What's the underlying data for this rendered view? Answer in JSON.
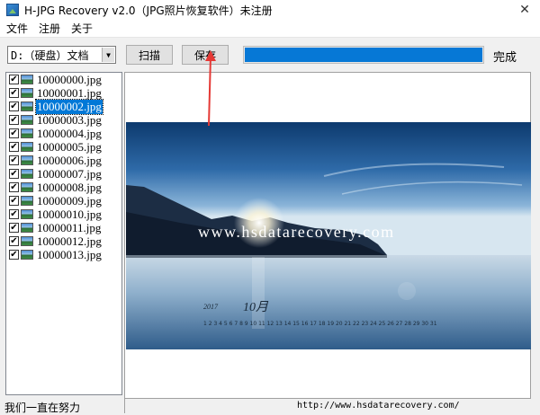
{
  "window": {
    "title": "H-JPG Recovery v2.0（JPG照片恢复软件）未注册",
    "close": "✕"
  },
  "menu": {
    "items": [
      {
        "label": "文件"
      },
      {
        "label": "注册"
      },
      {
        "label": "关于"
      }
    ]
  },
  "toolbar": {
    "drive": "D:（硬盘）文档",
    "scan_label": "扫描",
    "save_label": "保存",
    "progress": 1.0,
    "status": "完成"
  },
  "files": [
    {
      "name": "10000000.jpg",
      "checked": true,
      "selected": false
    },
    {
      "name": "10000001.jpg",
      "checked": true,
      "selected": false
    },
    {
      "name": "10000002.jpg",
      "checked": true,
      "selected": true
    },
    {
      "name": "10000003.jpg",
      "checked": true,
      "selected": false
    },
    {
      "name": "10000004.jpg",
      "checked": true,
      "selected": false
    },
    {
      "name": "10000005.jpg",
      "checked": true,
      "selected": false
    },
    {
      "name": "10000006.jpg",
      "checked": true,
      "selected": false
    },
    {
      "name": "10000007.jpg",
      "checked": true,
      "selected": false
    },
    {
      "name": "10000008.jpg",
      "checked": true,
      "selected": false
    },
    {
      "name": "10000009.jpg",
      "checked": true,
      "selected": false
    },
    {
      "name": "10000010.jpg",
      "checked": true,
      "selected": false
    },
    {
      "name": "10000011.jpg",
      "checked": true,
      "selected": false
    },
    {
      "name": "10000012.jpg",
      "checked": true,
      "selected": false
    },
    {
      "name": "10000013.jpg",
      "checked": true,
      "selected": false
    }
  ],
  "preview": {
    "watermark": "www.hsdatarecovery.com",
    "calendar_year": "2017",
    "calendar_month": "10月",
    "calendar_days": "1 2 3 4 5 6 7 8 9 10 11 12 13 14 15 16 17 18 19 20 21 22 23 24 25 26 27 28 29 30 31"
  },
  "statusbar": {
    "left": "我们一直在努力",
    "url": "http://www.hsdatarecovery.com/"
  },
  "colors": {
    "accent": "#0678d6",
    "selection": "#0078d7",
    "annotation": "#e53935"
  }
}
